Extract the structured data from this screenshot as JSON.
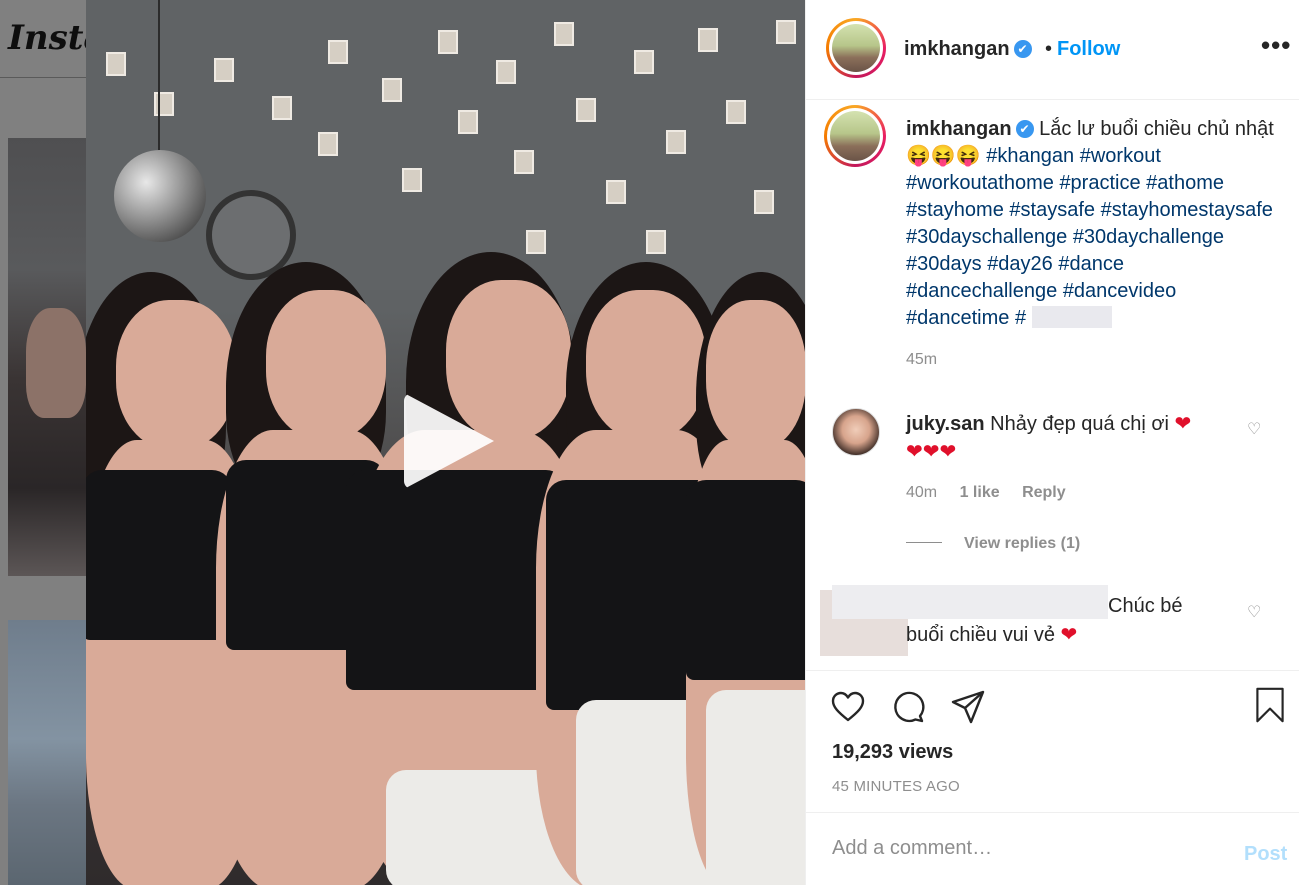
{
  "background": {
    "logo_text": "Insta"
  },
  "header": {
    "username": "imkhangan",
    "verified_icon": "✔",
    "separator": "•",
    "follow_label": "Follow",
    "more_label": "•••"
  },
  "caption": {
    "username": "imkhangan",
    "text": "Lắc lư buổi chiều chủ nhật",
    "emojis": "😝😝😝",
    "hashtags": [
      "#khangan",
      "#workout",
      "#workoutathome",
      "#practice",
      "#athome",
      "#stayhome",
      "#staysafe",
      "#stayhomestaysafe",
      "#30dayschallenge",
      "#30daychallenge",
      "#30days",
      "#day26",
      "#dance",
      "#dancechallenge",
      "#dancevideo",
      "#dancetime"
    ],
    "partial_hashtag": "#",
    "time": "45m"
  },
  "comments": [
    {
      "username": "juky.san",
      "text": "Nhảy đẹp quá chị ơi",
      "hearts": "❤",
      "hearts_line2": "❤❤❤",
      "time": "40m",
      "likes": "1 like",
      "reply_label": "Reply",
      "view_replies": "View replies (1)"
    },
    {
      "text_part1": "Chúc bé",
      "text_part2": "buổi chiều vui vẻ",
      "hearts": "❤"
    }
  ],
  "stats": {
    "views": "19,293 views",
    "posted": "45 MINUTES AGO"
  },
  "comment_box": {
    "placeholder": "Add a comment…",
    "post_label": "Post"
  },
  "colors": {
    "link_blue": "#0095f6",
    "hashtag": "#00376b",
    "secondary_text": "#8e8e8e",
    "post_disabled": "#b2dffc"
  }
}
